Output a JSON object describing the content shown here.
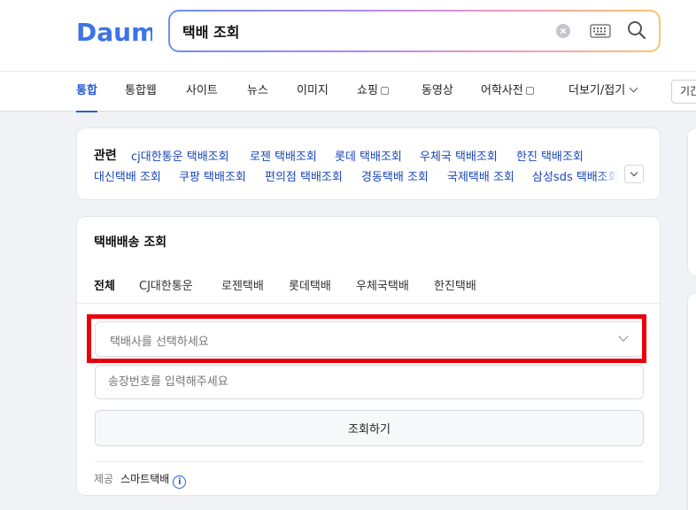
{
  "header": {
    "logo_text": "Daum",
    "search_value": "택배 조회"
  },
  "nav": {
    "items": [
      {
        "label": "통합"
      },
      {
        "label": "통합웹"
      },
      {
        "label": "사이트"
      },
      {
        "label": "뉴스"
      },
      {
        "label": "이미지"
      },
      {
        "label": "쇼핑"
      },
      {
        "label": "동영상"
      },
      {
        "label": "어학사전"
      },
      {
        "label": "더보기/접기"
      }
    ],
    "period_label": "기간"
  },
  "related": {
    "title": "관련",
    "links": [
      "cj대한통운 택배조회",
      "로젠 택배조회",
      "롯데 택배조회",
      "우체국 택배조회",
      "한진 택배조회",
      "대신택배 조회",
      "쿠팡 택배조회",
      "편의점 택배조회",
      "경동택배 조회",
      "국제택배 조회",
      "삼성sds 택배조회"
    ]
  },
  "tracking": {
    "title": "택배배송 조회",
    "tabs": [
      "전체",
      "CJ대한통운",
      "로젠택배",
      "롯데택배",
      "우체국택배",
      "한진택배"
    ],
    "select_placeholder": "택배사를 선택하세요",
    "input_placeholder": "송장번호를 입력해주세요",
    "submit_label": "조회하기",
    "provider_label": "제공",
    "provider_name": "스마트택배"
  },
  "colors": {
    "accent": "#2a5bd7",
    "link": "#1b47b8",
    "highlight": "#e8000b"
  }
}
